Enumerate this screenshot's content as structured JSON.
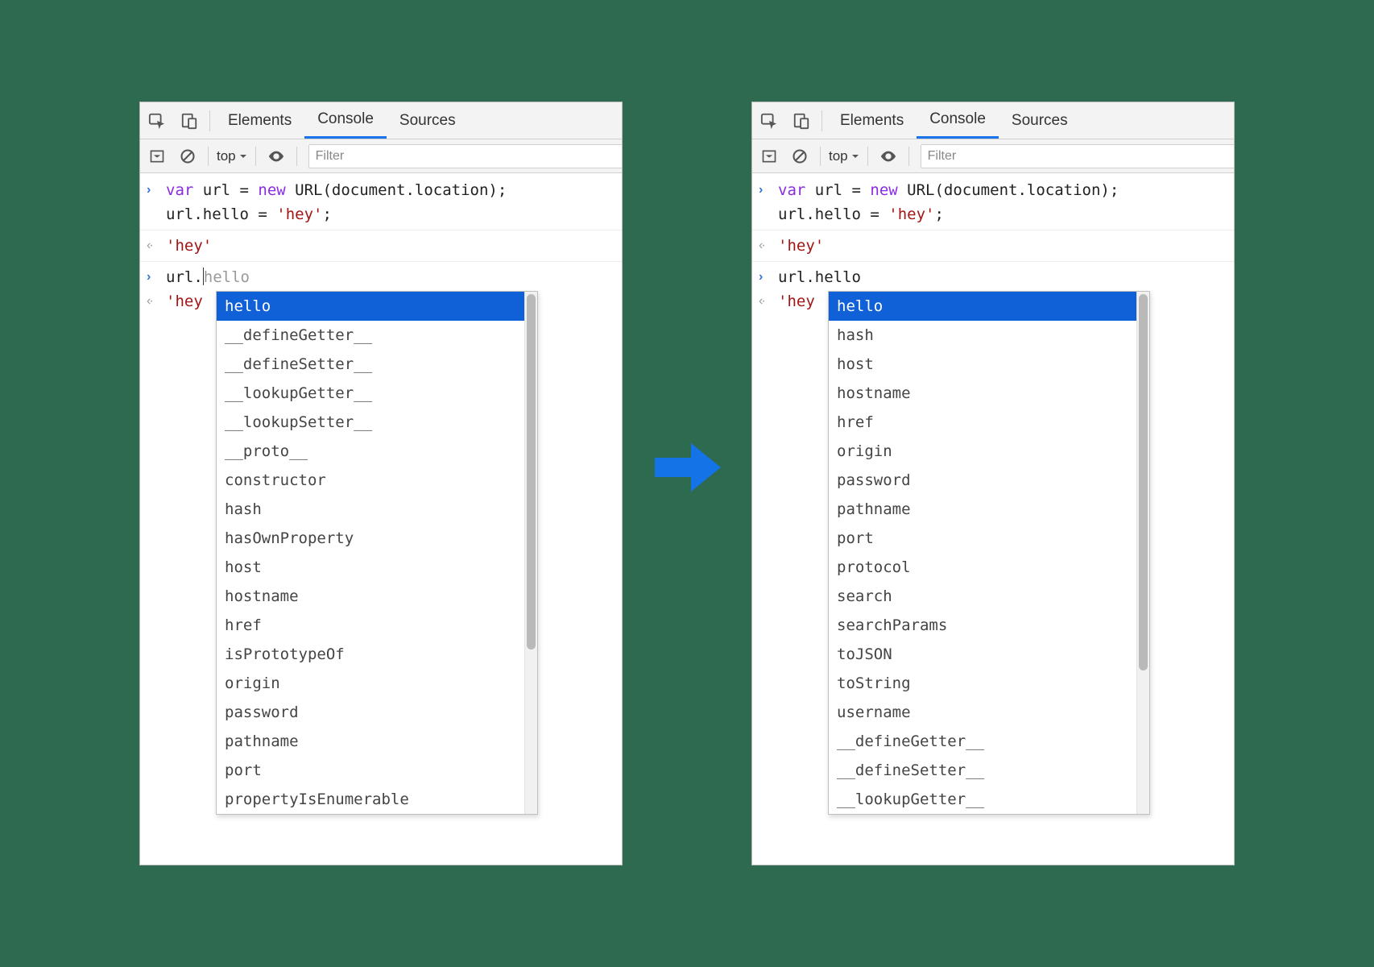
{
  "tabs": {
    "elements": "Elements",
    "console": "Console",
    "sources": "Sources"
  },
  "subbar": {
    "context": "top",
    "filter_placeholder": "Filter"
  },
  "code": {
    "line1_pre": "var",
    "line1_mid": " url = ",
    "line1_new": "new",
    "line1_post": " URL(document.location);",
    "line2": "url.hello = ",
    "line2_str": "'hey'",
    "line2_end": ";",
    "result": "'hey'",
    "input_prefix_left": "url.",
    "input_suffix_left": "hello",
    "input_full_right": "url.hello",
    "out2": "'hey"
  },
  "autocomplete_left": [
    "hello",
    "__defineGetter__",
    "__defineSetter__",
    "__lookupGetter__",
    "__lookupSetter__",
    "__proto__",
    "constructor",
    "hash",
    "hasOwnProperty",
    "host",
    "hostname",
    "href",
    "isPrototypeOf",
    "origin",
    "password",
    "pathname",
    "port",
    "propertyIsEnumerable"
  ],
  "autocomplete_right": [
    "hello",
    "hash",
    "host",
    "hostname",
    "href",
    "origin",
    "password",
    "pathname",
    "port",
    "protocol",
    "search",
    "searchParams",
    "toJSON",
    "toString",
    "username",
    "__defineGetter__",
    "__defineSetter__",
    "__lookupGetter__"
  ]
}
